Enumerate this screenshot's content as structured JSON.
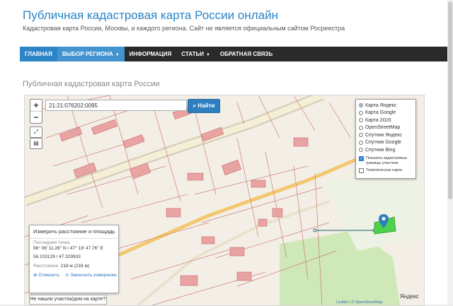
{
  "site": {
    "title": "Публичная кадастровая карта России онлайн",
    "subtitle": "Кадастровая карта России, Москвы, и каждого региона. Сайт не является официальным сайтом Росреестра"
  },
  "nav": {
    "items": [
      {
        "label": "ГЛАВНАЯ"
      },
      {
        "label": "ВЫБОР РЕГИОНА"
      },
      {
        "label": "ИНФОРМАЦИЯ"
      },
      {
        "label": "СТАТЬИ"
      },
      {
        "label": "ОБРАТНАЯ СВЯЗЬ"
      }
    ]
  },
  "section_title": "Публичная кадастровая карта России",
  "map": {
    "search_value": "21:21:076202:0095",
    "search_button": "Найти",
    "layers": [
      {
        "label": "Карта Яндекс",
        "selected": true
      },
      {
        "label": "Карта Google",
        "selected": false
      },
      {
        "label": "Карта 2GIS",
        "selected": false
      },
      {
        "label": "OpenStreetMap",
        "selected": false
      },
      {
        "label": "Спутник Яндекс",
        "selected": false
      },
      {
        "label": "Спутник Google",
        "selected": false
      },
      {
        "label": "Спутник Bing",
        "selected": false
      }
    ],
    "cadastral_borders": "Показать кадастровые границы участков",
    "thematic": "Тематическая карта",
    "measure": {
      "title": "Измерить расстояние и площадь",
      "last_point_label": "Последняя точка",
      "coords_dms": "56° 06' 11.26'' N / 47° 19' 47.76'' E",
      "coords_dec": "56.103129 / 47.329933",
      "distance_label": "Расстояние",
      "distance_value": "218 м (218 м)",
      "cancel": "Отменить",
      "finish": "Закончить измерение"
    },
    "not_found": "Не нашли участок/дом на карте?",
    "provider": "Яндекс",
    "attribution": "Leaflet | © OpenStreetMap"
  },
  "colors": {
    "accent": "#2d85c8",
    "navbar": "#2a2a2a",
    "parcel": "#c96a6a",
    "highlight": "#4cd24c"
  }
}
